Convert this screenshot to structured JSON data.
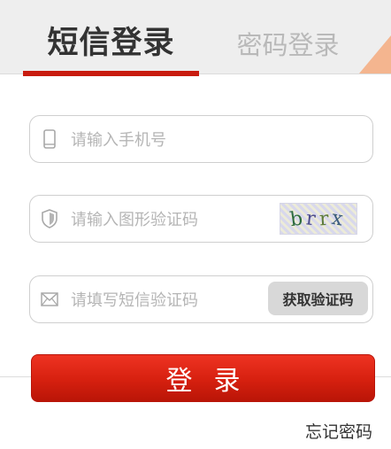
{
  "tabs": {
    "sms_login": "短信登录",
    "password_login": "密码登录",
    "active": "sms_login"
  },
  "form": {
    "phone_placeholder": "请输入手机号",
    "captcha_placeholder": "请输入图形验证码",
    "captcha_text": [
      "b",
      "r",
      "r",
      "x"
    ],
    "sms_code_placeholder": "请填写短信验证码",
    "get_code_label": "获取验证码"
  },
  "actions": {
    "login_label": "登录",
    "forgot_password": "忘记密码"
  },
  "icons": {
    "phone": "phone-icon",
    "shield": "shield-icon",
    "mail": "mail-icon"
  },
  "colors": {
    "accent": "#c81b0f",
    "button_top": "#ee3322",
    "button_bottom": "#b91507",
    "corner": "#f4b58f"
  }
}
